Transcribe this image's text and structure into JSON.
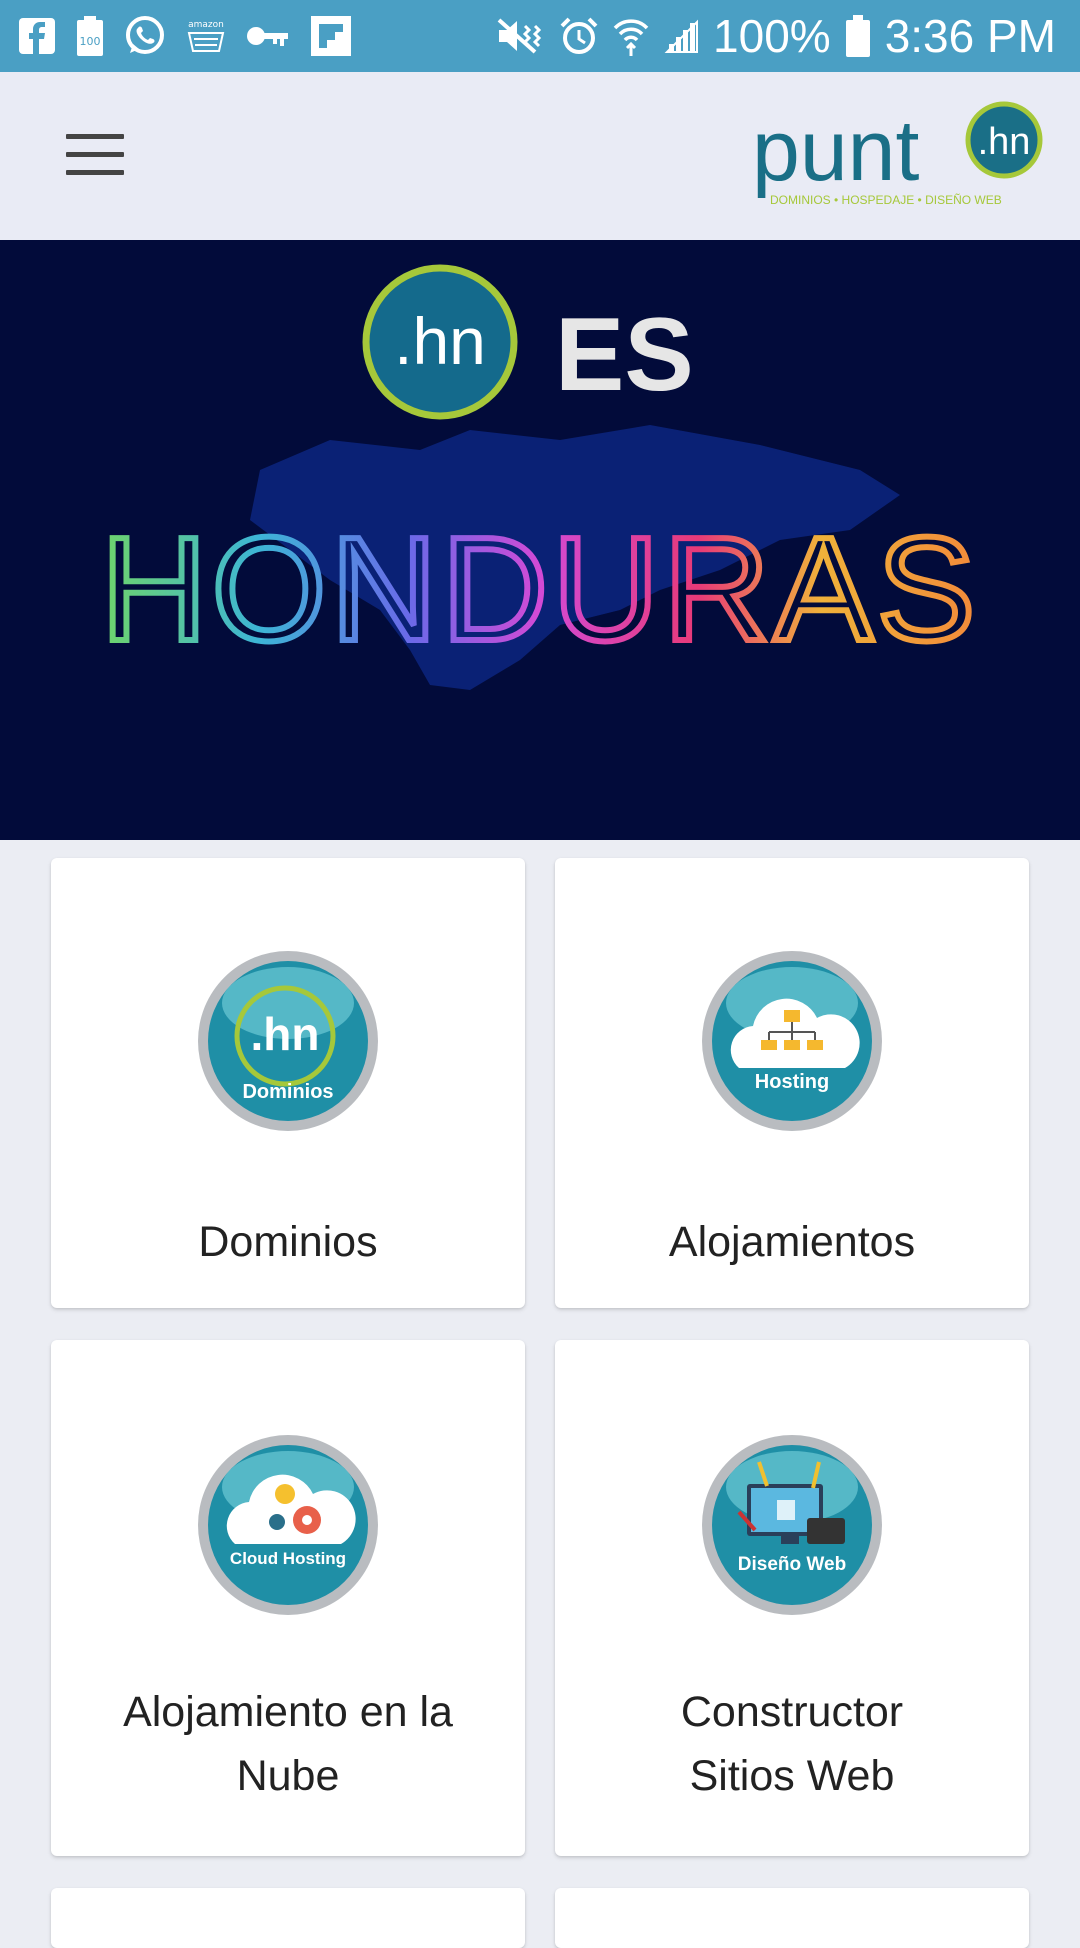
{
  "status_bar": {
    "battery_text": "100%",
    "time": "3:36 PM",
    "left_icons": [
      "facebook-icon",
      "battery-100-icon",
      "whatsapp-icon",
      "amazon-icon",
      "key-icon",
      "flipboard-icon"
    ],
    "right_icons": [
      "mute-icon",
      "alarm-icon",
      "wifi-icon",
      "signal-icon",
      "battery-icon"
    ]
  },
  "header": {
    "logo_text": "punt",
    "logo_badge": ".hn",
    "logo_tagline": "DOMINIOS • HOSPEDAJE • DISEÑO WEB"
  },
  "hero": {
    "badge": ".hn",
    "badge_suffix": "ES",
    "headline": "HONDURAS"
  },
  "cards": [
    {
      "label": "Dominios",
      "icon": "dominios-icon",
      "icon_text": ".hn",
      "icon_caption": "Dominios"
    },
    {
      "label": "Alojamientos",
      "icon": "hosting-icon",
      "icon_caption": "Hosting"
    },
    {
      "label": "Alojamiento en la Nube",
      "icon": "cloud-hosting-icon",
      "icon_caption": "Cloud Hosting"
    },
    {
      "label": "Constructor Sitios Web",
      "icon": "web-design-icon",
      "icon_caption": "Diseño Web"
    }
  ],
  "colors": {
    "status_bar": "#4a9fc4",
    "brand_teal": "#1a6f87",
    "brand_green": "#a6c83a",
    "hero_bg": "#020b3a"
  }
}
